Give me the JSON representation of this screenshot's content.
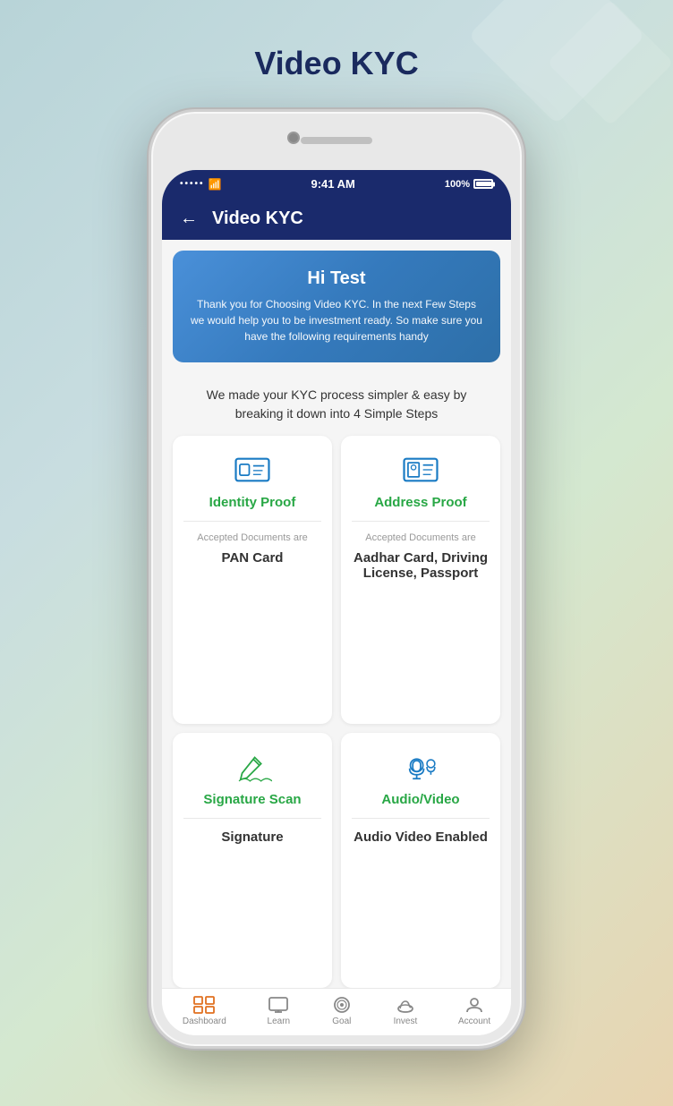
{
  "page": {
    "title": "Video KYC",
    "background_shape": true
  },
  "status_bar": {
    "signal": "•••••",
    "wifi": "WiFi",
    "time": "9:41 AM",
    "battery_percent": "100%"
  },
  "nav": {
    "back_label": "←",
    "title": "Video KYC"
  },
  "welcome_banner": {
    "greeting": "Hi Test",
    "description": "Thank you for Choosing Video KYC. In the next Few Steps we would help you to be investment ready. So make sure you have the following requirements handy"
  },
  "steps_text": "We made your KYC process simpler & easy by breaking it down into 4 Simple Steps",
  "cards": [
    {
      "id": "identity-proof",
      "title": "Identity Proof",
      "subtitle": "Accepted Documents are",
      "value": "PAN Card",
      "icon": "id-card"
    },
    {
      "id": "address-proof",
      "title": "Address Proof",
      "subtitle": "Accepted Documents are",
      "value": "Aadhar Card, Driving License, Passport",
      "icon": "address-card"
    },
    {
      "id": "signature-scan",
      "title": "Signature Scan",
      "subtitle": "",
      "value": "Signature",
      "icon": "pen-signature"
    },
    {
      "id": "audio-video",
      "title": "Audio/Video",
      "subtitle": "",
      "value": "Audio Video Enabled",
      "icon": "audio-video"
    }
  ],
  "bottom_nav": [
    {
      "id": "dashboard",
      "label": "Dashboard",
      "icon": "grid"
    },
    {
      "id": "learn",
      "label": "Learn",
      "icon": "monitor"
    },
    {
      "id": "goal",
      "label": "Goal",
      "icon": "target"
    },
    {
      "id": "invest",
      "label": "Invest",
      "icon": "piggy"
    },
    {
      "id": "account",
      "label": "Account",
      "icon": "person"
    }
  ]
}
